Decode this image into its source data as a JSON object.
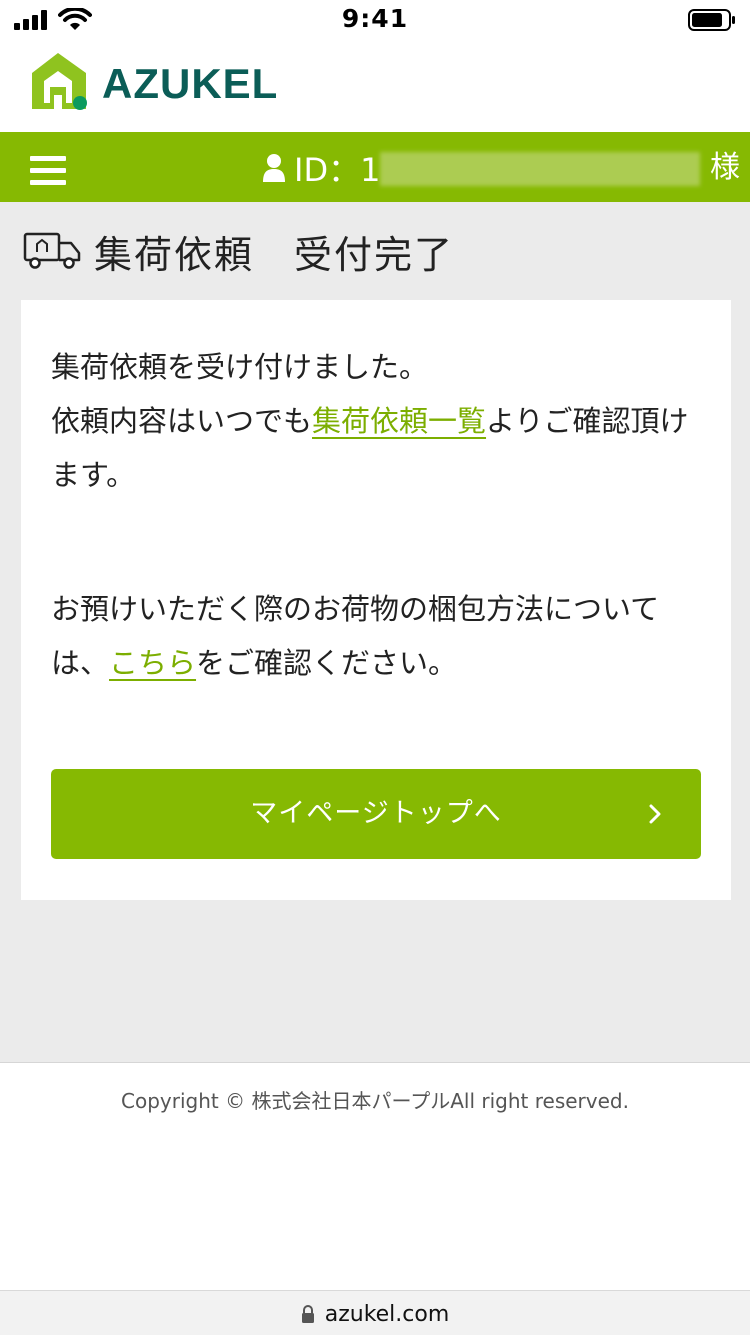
{
  "status_bar": {
    "time": "9:41"
  },
  "brand": {
    "name": "AZUKEL",
    "accent": "#86b902",
    "logo_text_color": "#0b5d57"
  },
  "nav": {
    "menu_icon": "hamburger-icon",
    "user_icon": "user-icon",
    "user_id_label": "ID：1",
    "honorific": "様"
  },
  "page": {
    "title": "集荷依頼　受付完了",
    "title_icon": "truck-icon"
  },
  "message": {
    "line1": "集荷依頼を受け付けました。",
    "line2_before": "依頼内容はいつでも",
    "line2_link": "集荷依頼一覧",
    "line2_after": "よりご確認頂けます。",
    "para2_before": "お預けいただく際のお荷物の梱包方法については、",
    "para2_link": "こちら",
    "para2_after": "をご確認ください。"
  },
  "buttons": {
    "mypage_top": "マイページトップへ"
  },
  "footer": {
    "copyright": "Copyright © 株式会社日本パープルAll right reserved."
  },
  "browser": {
    "url": "azukel.com"
  }
}
